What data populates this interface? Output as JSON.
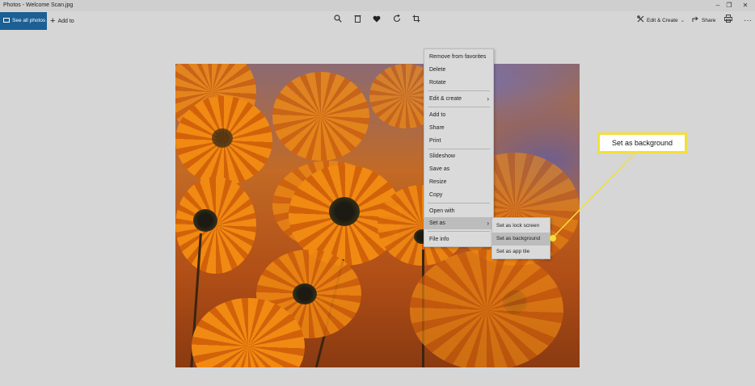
{
  "window": {
    "title": "Photos - Welcome Scan.jpg",
    "minimize_glyph": "–",
    "restore_glyph": "❐",
    "close_glyph": "✕"
  },
  "toolbar": {
    "see_all_label": "See all photos",
    "add_to_label": "Add to",
    "edit_create_label": "Edit & Create",
    "share_label": "Share",
    "more_glyph": "···",
    "icons": [
      "zoom-icon",
      "delete-icon",
      "favorite-icon",
      "rotate-icon",
      "crop-icon",
      "print-icon"
    ]
  },
  "context_menu": {
    "items": [
      {
        "label": "Remove from favorites"
      },
      {
        "label": "Delete"
      },
      {
        "label": "Rotate"
      },
      {
        "label": "Edit & create",
        "submenu": true
      },
      {
        "label": "Add to"
      },
      {
        "label": "Share"
      },
      {
        "label": "Print"
      },
      {
        "label": "Slideshow"
      },
      {
        "label": "Save as"
      },
      {
        "label": "Resize"
      },
      {
        "label": "Copy"
      },
      {
        "label": "Open with"
      },
      {
        "label": "Set as",
        "submenu": true,
        "selected": true
      },
      {
        "label": "File info"
      }
    ],
    "arrow_glyph": "›"
  },
  "submenu": {
    "items": [
      {
        "label": "Set as lock screen"
      },
      {
        "label": "Set as background",
        "selected": true
      },
      {
        "label": "Set as app tile"
      }
    ]
  },
  "callout": {
    "label": "Set as background",
    "color": "#f3df3b"
  },
  "colors": {
    "accent": "#1b5f94",
    "overlay_background": "#d6d6d6"
  }
}
